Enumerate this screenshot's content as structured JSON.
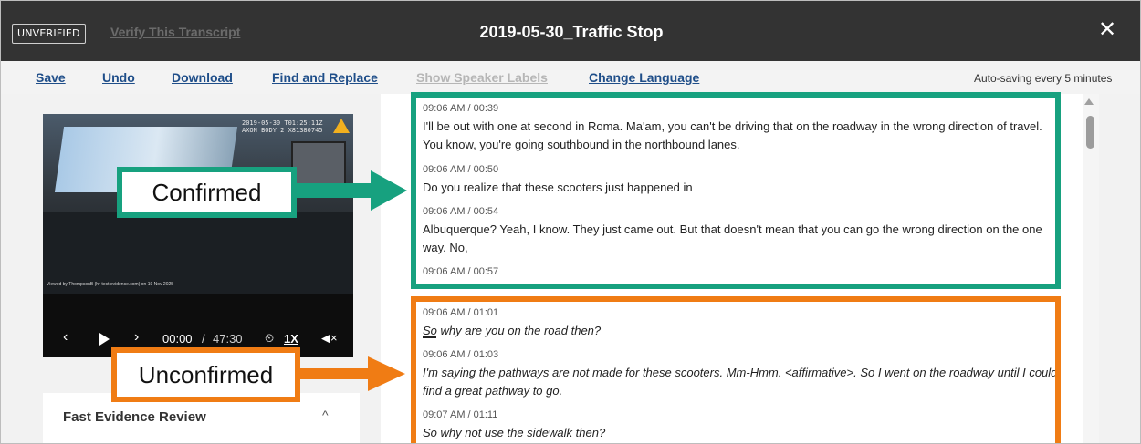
{
  "header": {
    "status_badge": "UNVERIFIED",
    "verify_link": "Verify This Transcript",
    "title": "2019-05-30_Traffic Stop",
    "close_glyph": "✕"
  },
  "toolbar": {
    "save": "Save",
    "undo": "Undo",
    "download": "Download",
    "find_replace": "Find and Replace",
    "speaker_labels": "Show Speaker Labels",
    "change_language": "Change Language",
    "autosave": "Auto-saving every 5 minutes"
  },
  "video": {
    "overlay_text": "2019-05-30 T01:25:11Z\nAXON BODY 2 X81380745",
    "watermark": "Viewed by ThompsonB (hr-test.evidence.com) on 19 Nov 2025",
    "current_time": "00:00",
    "separator": "/",
    "duration": "47:30",
    "speed": "1X",
    "progress": 0
  },
  "fast_evidence_review": {
    "title": "Fast Evidence Review"
  },
  "transcript": {
    "confirmed": [
      {
        "time": "09:06 AM / 00:39",
        "text": "I'll be out with one at second in Roma. Ma'am, you can't be driving that on the roadway in the wrong direction of travel. You know, you're going southbound in the northbound lanes."
      },
      {
        "time": "09:06 AM / 00:50",
        "text": "Do you realize that these scooters just happened in"
      },
      {
        "time": "09:06 AM / 00:54",
        "text": "Albuquerque? Yeah, I know. They just came out. But that doesn't mean that you can go the wrong direction on the one way. No,"
      },
      {
        "time": "09:06 AM / 00:57",
        "text": ""
      }
    ],
    "unconfirmed": [
      {
        "time": "09:06 AM / 01:01",
        "text": "So why are you on the road then?"
      },
      {
        "time": "09:06 AM / 01:03",
        "text": "I'm saying the pathways are not made for these scooters. Mm-Hmm. <affirmative>. So I went on the roadway until I could find a great pathway to go."
      },
      {
        "time": "09:07 AM / 01:11",
        "text": "So why not use the sidewalk then?"
      }
    ]
  },
  "annotations": {
    "confirmed_label": "Confirmed",
    "unconfirmed_label": "Unconfirmed",
    "confirmed_color": "#17a17f",
    "unconfirmed_color": "#f07c14"
  },
  "icons": {
    "prev": "chevron-left-icon",
    "play": "play-icon",
    "next": "chevron-right-icon",
    "speed": "speed-gauge-icon",
    "mute": "mute-icon",
    "collapse": "chevron-up-icon"
  }
}
